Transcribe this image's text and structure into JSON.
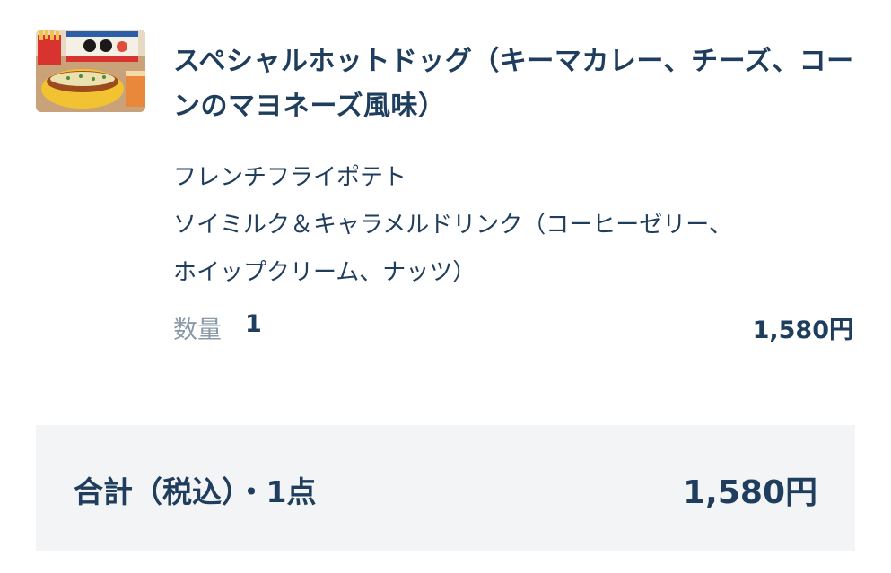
{
  "cart_item": {
    "image_icon": "hotdog-set-photo",
    "name": "スペシャルホットドッグ（キーマカレー、チーズ、コーンのマヨネーズ風味）",
    "options": [
      "フレンチフライポテト",
      "ソイミルク＆キャラメルドリンク（コーヒーゼリー、",
      "ホイップクリーム、ナッツ）"
    ],
    "quantity_label": "数量",
    "quantity_value": "1",
    "price": "1,580円"
  },
  "summary": {
    "total_label": "合計（税込）・1点",
    "total_price": "1,580円"
  },
  "colors": {
    "text_primary": "#1f3d5c",
    "text_muted": "#8a98a8",
    "summary_bg": "#f2f4f6"
  }
}
